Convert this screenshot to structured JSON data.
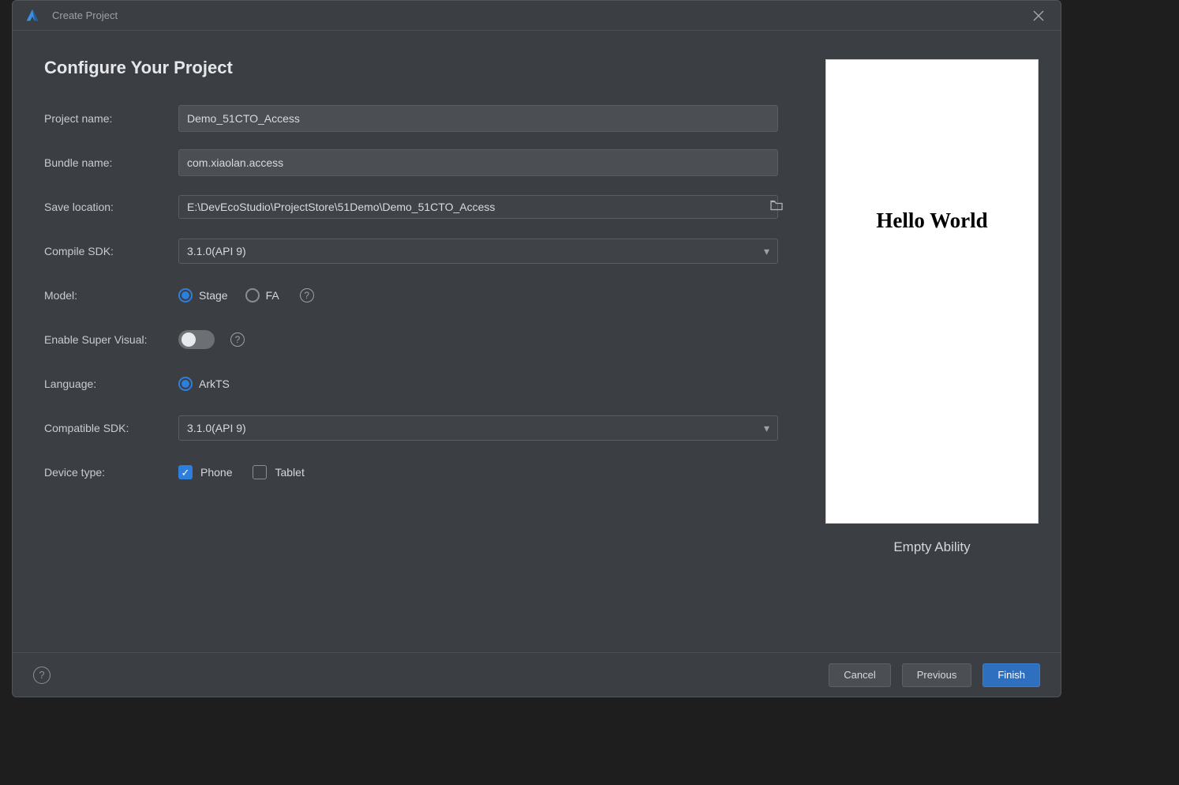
{
  "titlebar": {
    "title": "Create Project"
  },
  "page_title": "Configure Your Project",
  "form": {
    "project_name": {
      "label": "Project name:",
      "value": "Demo_51CTO_Access"
    },
    "bundle_name": {
      "label": "Bundle name:",
      "value": "com.xiaolan.access"
    },
    "save_location": {
      "label": "Save location:",
      "value": "E:\\DevEcoStudio\\ProjectStore\\51Demo\\Demo_51CTO_Access"
    },
    "compile_sdk": {
      "label": "Compile SDK:",
      "value": "3.1.0(API 9)"
    },
    "model": {
      "label": "Model:",
      "options": {
        "stage": "Stage",
        "fa": "FA"
      },
      "selected": "stage"
    },
    "enable_super_visual": {
      "label": "Enable Super Visual:",
      "value": false
    },
    "language": {
      "label": "Language:",
      "options": {
        "arkts": "ArkTS"
      },
      "selected": "arkts"
    },
    "compatible_sdk": {
      "label": "Compatible SDK:",
      "value": "3.1.0(API 9)"
    },
    "device_type": {
      "label": "Device type:",
      "options": {
        "phone": "Phone",
        "tablet": "Tablet"
      },
      "checked": [
        "phone"
      ]
    }
  },
  "preview": {
    "text": "Hello World",
    "caption": "Empty Ability"
  },
  "footer": {
    "cancel": "Cancel",
    "previous": "Previous",
    "finish": "Finish"
  }
}
